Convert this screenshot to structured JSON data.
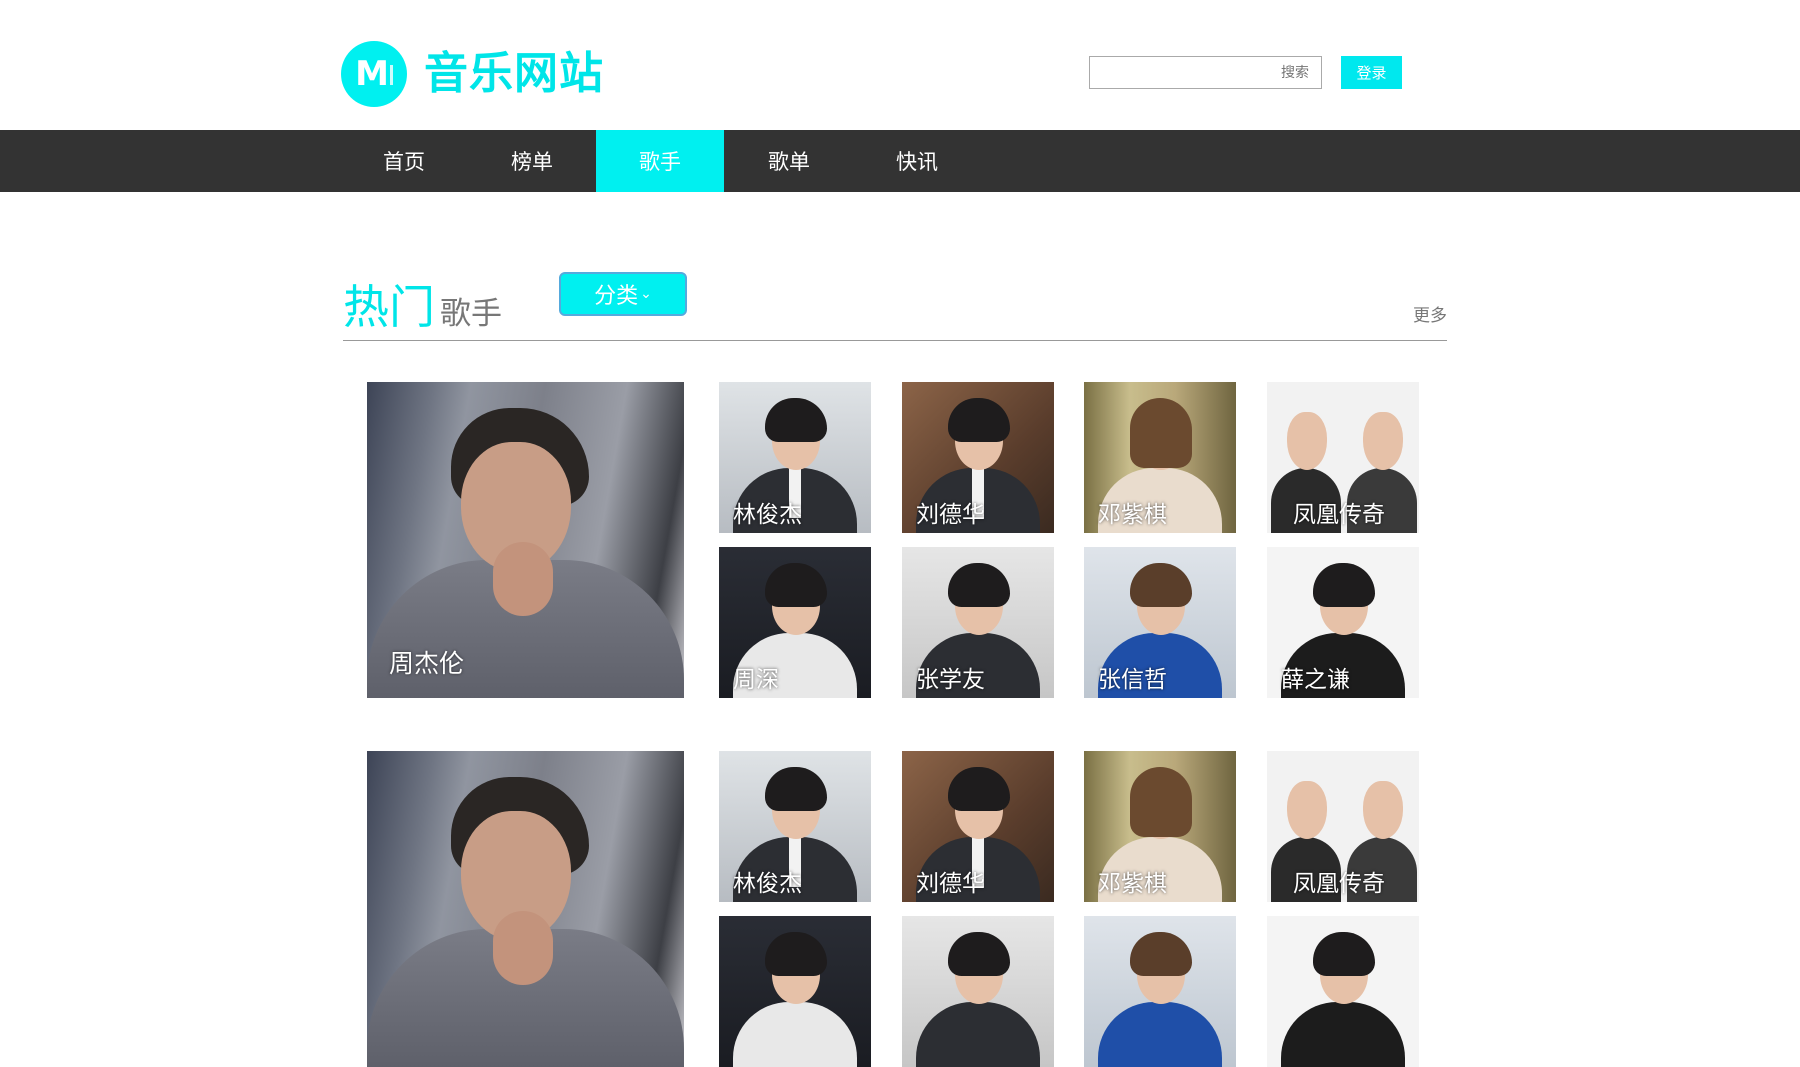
{
  "brand": {
    "title": "音乐网站",
    "logo_letter": "M"
  },
  "search": {
    "placeholder": "搜索",
    "value": ""
  },
  "header": {
    "login_label": "登录"
  },
  "nav": {
    "items": [
      {
        "label": "首页",
        "active": false
      },
      {
        "label": "榜单",
        "active": false
      },
      {
        "label": "歌手",
        "active": true
      },
      {
        "label": "歌单",
        "active": false
      },
      {
        "label": "快讯",
        "active": false
      }
    ]
  },
  "section": {
    "title_highlight": "热门",
    "title_rest": "歌手",
    "category_label": "分类",
    "category_icon": "chevron-down-icon",
    "more_label": "更多"
  },
  "featured": {
    "name": "周杰伦"
  },
  "singers": [
    {
      "name": "林俊杰",
      "bg": "grey"
    },
    {
      "name": "刘德华",
      "bg": "brown"
    },
    {
      "name": "邓紫棋",
      "bg": "gold"
    },
    {
      "name": "凤凰传奇",
      "bg": "white"
    },
    {
      "name": "周深",
      "bg": "dark"
    },
    {
      "name": "张学友",
      "bg": "soft"
    },
    {
      "name": "张信哲",
      "bg": "blue"
    },
    {
      "name": "薛之谦",
      "bg": "light"
    }
  ],
  "colors": {
    "accent": "#00f0f0",
    "nav_bg": "#333333",
    "text_muted": "#777777"
  }
}
